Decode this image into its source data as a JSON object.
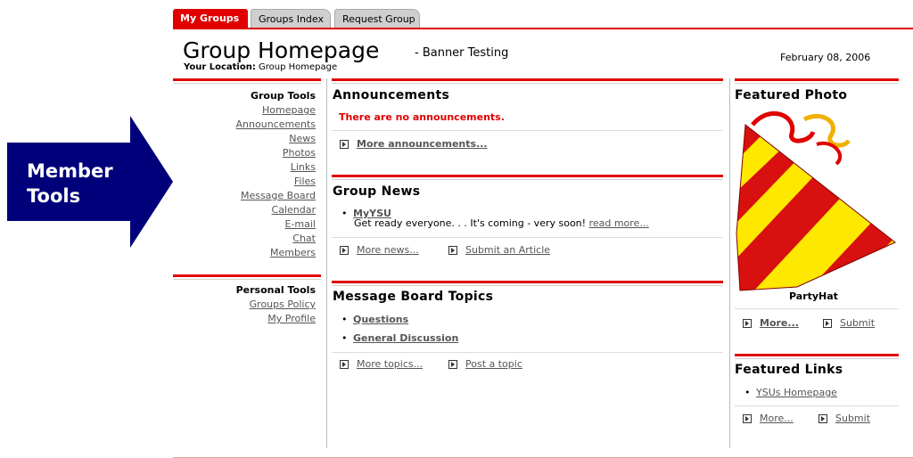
{
  "callout": {
    "line1": "Member",
    "line2": "Tools"
  },
  "tabs": [
    {
      "label": "My Groups",
      "active": true
    },
    {
      "label": "Groups Index",
      "active": false
    },
    {
      "label": "Request Group",
      "active": false
    }
  ],
  "header": {
    "title": "Group Homepage",
    "subtitle": "- Banner Testing",
    "location_label": "Your Location:",
    "location_value": "Group Homepage",
    "date": "February 08, 2006"
  },
  "group_tools": {
    "heading": "Group Tools",
    "links": [
      "Homepage",
      "Announcements",
      "News",
      "Photos",
      "Links",
      "Files",
      "Message Board",
      "Calendar",
      "E-mail",
      "Chat",
      "Members"
    ]
  },
  "personal_tools": {
    "heading": "Personal Tools",
    "links": [
      "Groups Policy",
      "My Profile"
    ]
  },
  "announcements": {
    "title": "Announcements",
    "empty_message": "There are no announcements.",
    "more_label": "More announcements..."
  },
  "group_news": {
    "title": "Group News",
    "item_title": "MyYSU",
    "item_text": "Get ready everyone. . . It's coming - very soon!",
    "read_more": "read more...",
    "more_label": "More news...",
    "submit_label": "Submit an Article"
  },
  "message_board": {
    "title": "Message Board Topics",
    "topics": [
      "Questions",
      "General Discussion"
    ],
    "more_label": "More topics...",
    "post_label": "Post a topic"
  },
  "featured_photo": {
    "title": "Featured Photo",
    "caption": "PartyHat",
    "more_label": "More...",
    "submit_label": "Submit"
  },
  "featured_links": {
    "title": "Featured Links",
    "links": [
      "YSUs Homepage"
    ],
    "more_label": "More...",
    "submit_label": "Submit"
  },
  "colors": {
    "accent": "#e00000",
    "callout": "#00007a"
  }
}
